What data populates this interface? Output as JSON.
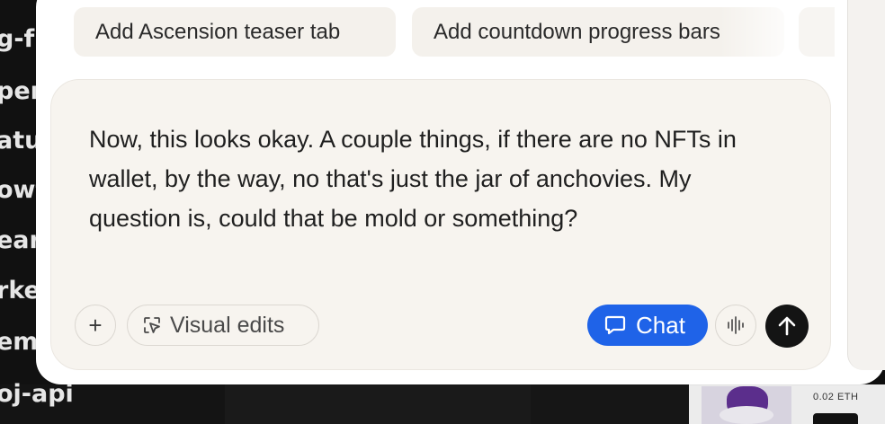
{
  "background": {
    "left_fragments": [
      "g-fr",
      "per",
      "atur",
      "owt",
      "ear",
      "rke",
      "eme",
      "oj-api"
    ],
    "nft_card": {
      "price": "0.02 ETH"
    }
  },
  "suggestions": [
    {
      "label": "Add Ascension teaser tab"
    },
    {
      "label": "Add countdown progress bars"
    }
  ],
  "composer": {
    "message": "Now, this looks okay. A couple things, if there are no NFTs in wallet, by the way, no that's just the jar of anchovies. My question is, could that be mold or something?",
    "plus_label": "+",
    "visual_edits_label": "Visual edits",
    "chat_label": "Chat"
  },
  "colors": {
    "accent": "#1f63e8",
    "send": "#141414",
    "composer_bg": "#f7f4ef",
    "chip_bg": "#f4f1ec"
  },
  "icons": [
    "plus-icon",
    "visual-edits-icon",
    "chat-bubble-icon",
    "voice-waveform-icon",
    "arrow-up-icon"
  ]
}
